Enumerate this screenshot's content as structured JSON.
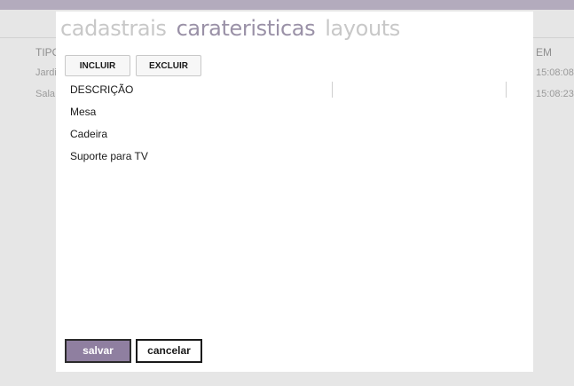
{
  "background": {
    "table": {
      "col_tipo": "TIPO",
      "col_em": "EM",
      "rows": [
        {
          "tipo": "Jardi",
          "time": "15:08:08"
        },
        {
          "tipo": "Sala",
          "time": "15:08:23"
        }
      ]
    }
  },
  "modal": {
    "tabs": [
      {
        "label": "cadastrais",
        "active": false
      },
      {
        "label": "carateristicas",
        "active": true
      },
      {
        "label": "layouts",
        "active": false
      }
    ],
    "toolbar": {
      "incluir_label": "INCLUIR",
      "excluir_label": "EXCLUIR"
    },
    "grid": {
      "columns": [
        "DESCRIÇÃO",
        "",
        ""
      ],
      "rows": [
        "Mesa",
        "Cadeira",
        "Suporte para TV"
      ]
    },
    "footer": {
      "salvar_label": "salvar",
      "cancelar_label": "cancelar"
    }
  },
  "colors": {
    "accent": "#8f7fa0",
    "active_tab": "#9a91a7",
    "inactive_tab": "#c8c8c8",
    "top_strip": "#b3abbd"
  }
}
